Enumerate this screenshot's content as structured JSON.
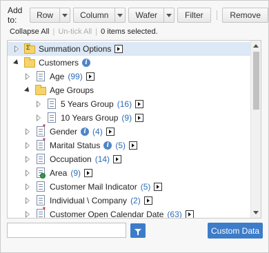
{
  "toolbar": {
    "add_to_label": "Add to:",
    "row_label": "Row",
    "column_label": "Column",
    "wafer_label": "Wafer",
    "filter_label": "Filter",
    "remove_label": "Remove"
  },
  "links": {
    "collapse_all": "Collapse All",
    "untick_all": "Un-tick All",
    "selection_status": "0 items selected."
  },
  "tree": [
    {
      "label": "Summation Options",
      "count": "",
      "icon": "summation-folder-icon",
      "toggle": "collapsed",
      "level": 0,
      "selected": true,
      "info": false
    },
    {
      "label": "Customers",
      "count": "",
      "icon": "folder-icon",
      "toggle": "expanded",
      "level": 0,
      "selected": false,
      "info": true
    },
    {
      "label": "Age",
      "count": "(99)",
      "icon": "dimension-icon",
      "toggle": "collapsed",
      "level": 1,
      "selected": false,
      "info": false
    },
    {
      "label": "Age Groups",
      "count": "",
      "icon": "folder-icon",
      "toggle": "expanded",
      "level": 1,
      "selected": false,
      "info": false
    },
    {
      "label": "5 Years Group",
      "count": "(16)",
      "icon": "dimension-icon",
      "toggle": "collapsed",
      "level": 2,
      "selected": false,
      "info": false
    },
    {
      "label": "10 Years Group",
      "count": "(9)",
      "icon": "dimension-icon",
      "toggle": "collapsed",
      "level": 2,
      "selected": false,
      "info": false
    },
    {
      "label": "Gender",
      "count": "(4)",
      "icon": "required-dimension-icon",
      "toggle": "collapsed",
      "level": 1,
      "selected": false,
      "info": true
    },
    {
      "label": "Marital Status",
      "count": "(5)",
      "icon": "required-dimension-icon",
      "toggle": "collapsed",
      "level": 1,
      "selected": false,
      "info": true
    },
    {
      "label": "Occupation",
      "count": "(14)",
      "icon": "dimension-icon",
      "toggle": "collapsed",
      "level": 1,
      "selected": false,
      "info": false
    },
    {
      "label": "Area",
      "count": "(9)",
      "icon": "geo-dimension-icon",
      "toggle": "collapsed",
      "level": 1,
      "selected": false,
      "info": false
    },
    {
      "label": "Customer Mail Indicator",
      "count": "(5)",
      "icon": "dimension-icon",
      "toggle": "collapsed",
      "level": 1,
      "selected": false,
      "info": false
    },
    {
      "label": "Individual \\ Company",
      "count": "(2)",
      "icon": "dimension-icon",
      "toggle": "collapsed",
      "level": 1,
      "selected": false,
      "info": false
    },
    {
      "label": "Customer Open Calendar Date",
      "count": "(63)",
      "icon": "required-dimension-icon",
      "toggle": "collapsed",
      "level": 1,
      "selected": false,
      "info": false
    }
  ],
  "search": {
    "value": "",
    "placeholder": ""
  },
  "custom_data_label": "Custom Data"
}
